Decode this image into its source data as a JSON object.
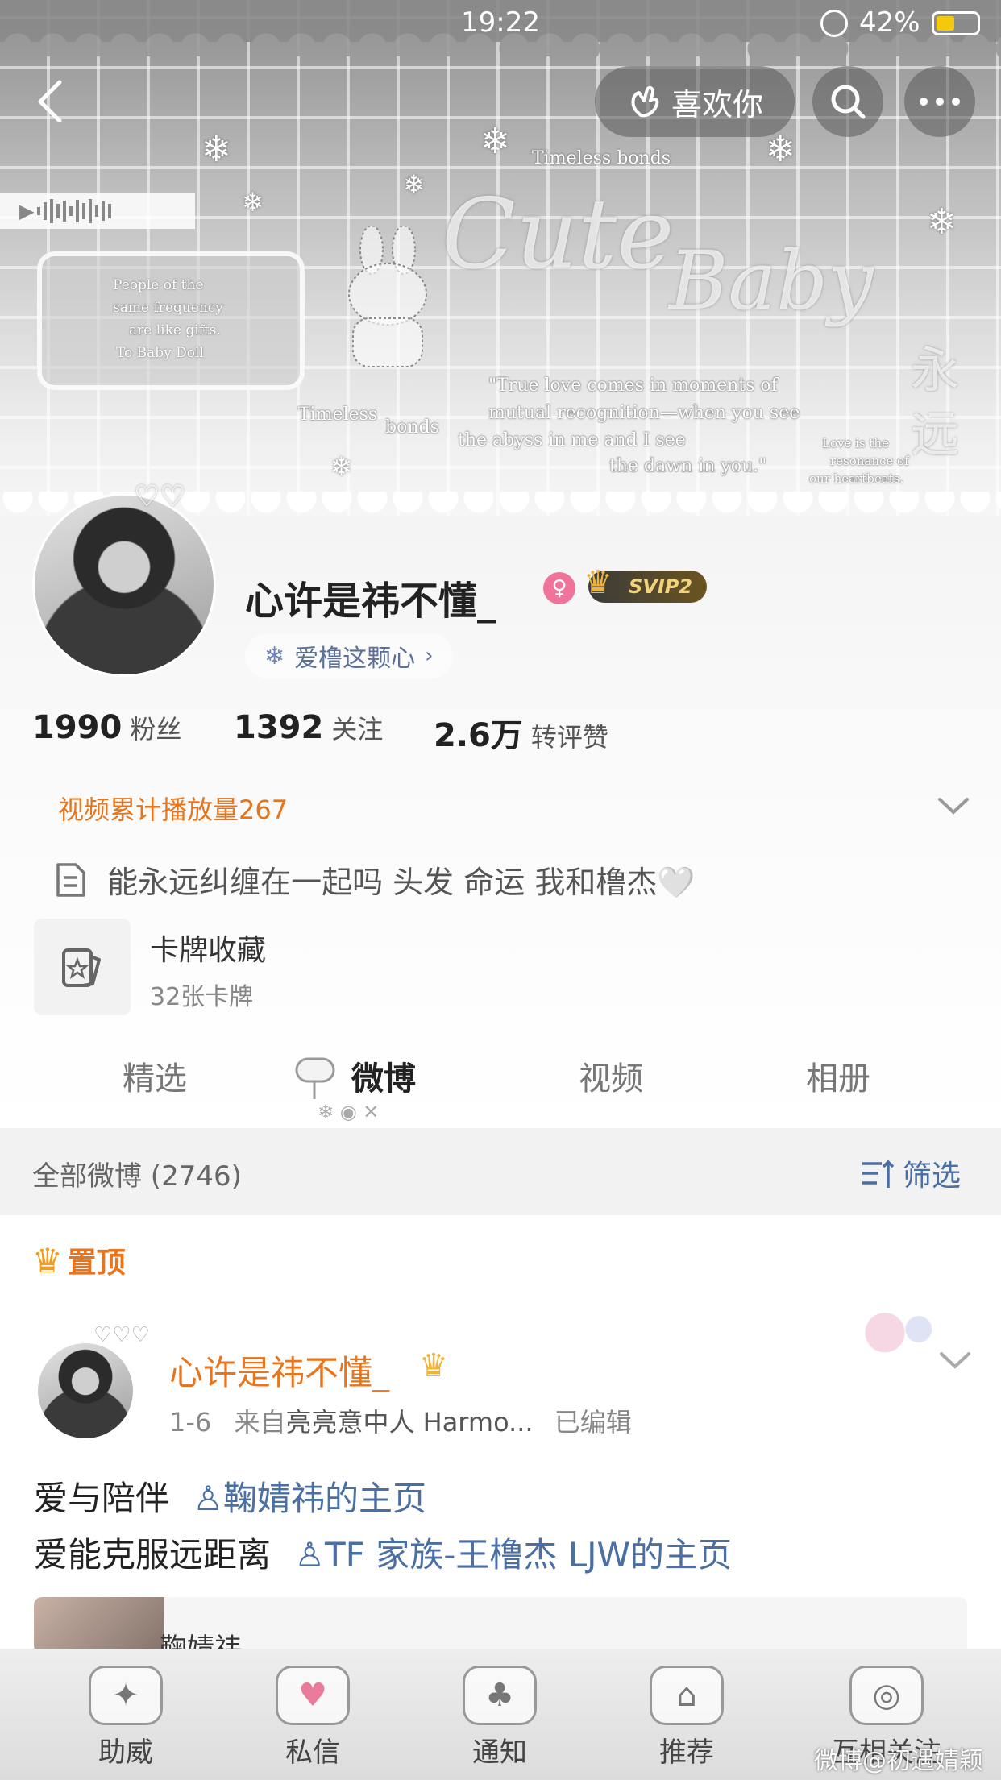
{
  "status_bar": {
    "time": "19:22",
    "battery": "42%"
  },
  "header": {
    "like_button_label": "喜欢你"
  },
  "banner": {
    "title_word_1": "Cute",
    "title_word_2": "Baby",
    "timeless_top": "Timeless bonds",
    "timeless_left_1": "Timeless",
    "timeless_left_2": "bonds",
    "card_note_lines": [
      "People of the",
      "same frequency",
      "are like gifts.",
      "To Baby Doll"
    ],
    "quote_lines": [
      "\"True love comes in moments of",
      "mutual recognition—when you see",
      "the abyss in me and I see",
      "the dawn in you.\""
    ],
    "side_lines": [
      "Love is the",
      "resonance of",
      "our heartbeats."
    ],
    "side_glyph": "永远"
  },
  "profile": {
    "name": "心许是祎不懂_",
    "svip_label": "SVIP2",
    "fan_group_label": "爱橹这颗心",
    "stats": [
      {
        "value": "1990",
        "label": "粉丝"
      },
      {
        "value": "1392",
        "label": "关注"
      },
      {
        "value": "2.6万",
        "label": "转评赞"
      }
    ],
    "video_plays": "视频累计播放量267",
    "bio": "能永远纠缠在一起吗 头发 命运 我和橹杰🤍",
    "card_collection": {
      "title": "卡牌收藏",
      "subtitle": "32张卡牌"
    }
  },
  "tabs": [
    {
      "label": "精选",
      "active": false
    },
    {
      "label": "微博",
      "active": true
    },
    {
      "label": "视频",
      "active": false
    },
    {
      "label": "相册",
      "active": false
    }
  ],
  "filter_bar": {
    "all_label": "全部微博 (2746)",
    "filter_label": "筛选"
  },
  "pinned_label": "置顶",
  "post": {
    "author": "心许是祎不懂_",
    "meta_date": "1-6",
    "meta_from": "来自",
    "meta_device": "亮亮意中人 Harmo...",
    "meta_edited": "已编辑",
    "line1_text": "爱与陪伴",
    "line1_link": "鞠婧祎的主页",
    "line2_text": "爱能克服远距离",
    "line2_link": "TF 家族-王橹杰 LJW的主页",
    "preview_title": "鞠婧祎"
  },
  "bottom_nav": [
    {
      "label": "助威",
      "icon": "cheer-icon"
    },
    {
      "label": "私信",
      "icon": "message-icon"
    },
    {
      "label": "通知",
      "icon": "bell-icon"
    },
    {
      "label": "推荐",
      "icon": "house-icon"
    },
    {
      "label": "互相关注",
      "icon": "record-icon"
    }
  ],
  "watermark": "微博@初遇婧颖",
  "colors": {
    "accent_orange": "#e8741b",
    "link_blue": "#4a6fa5",
    "svip_gold": "#f3d37a"
  }
}
